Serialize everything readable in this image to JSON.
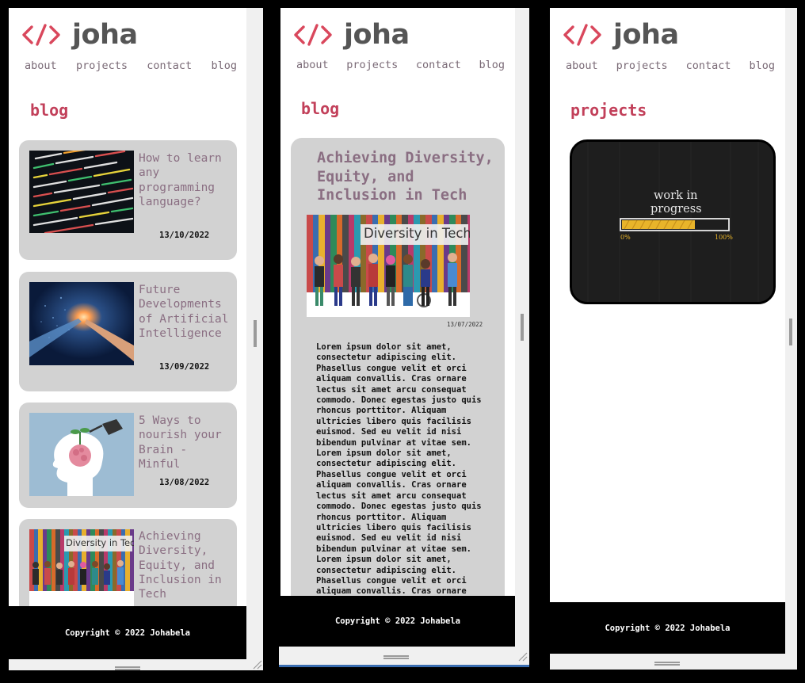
{
  "site": {
    "logo_text": "joha",
    "nav": [
      "about",
      "projects",
      "contact",
      "blog"
    ],
    "footer": "Copyright © 2022 Johabela"
  },
  "panel1": {
    "section_title": "blog",
    "cards": [
      {
        "title": "How to learn any programming language?",
        "date": "13/10/2022",
        "image": "code-screen-image"
      },
      {
        "title": "Future Developments of Artificial Intelligence",
        "date": "13/09/2022",
        "image": "robot-hand-image"
      },
      {
        "title": "5 Ways to nourish your Brain - Minful",
        "date": "13/08/2022",
        "image": "brain-watering-image"
      },
      {
        "title": "Achieving Diversity, Equity, and Inclusion in Tech",
        "date": "",
        "image": "diversity-image"
      }
    ]
  },
  "panel2": {
    "section_title": "blog",
    "article": {
      "title": "Achieving Diversity, Equity, and Inclusion in Tech",
      "image_caption": "Diversity in Tech",
      "date": "13/07/2022",
      "body": "Lorem ipsum dolor sit amet, consectetur adipiscing elit. Phasellus congue velit et orci aliquam convallis. Cras ornare lectus sit amet arcu consequat commodo. Donec egestas justo quis rhoncus porttitor. Aliquam ultricies libero quis facilisis euismod. Sed eu velit id nisi bibendum pulvinar at vitae sem. Lorem ipsum dolor sit amet, consectetur adipiscing elit. Phasellus congue velit et orci aliquam convallis. Cras ornare lectus sit amet arcu consequat commodo. Donec egestas justo quis rhoncus porttitor. Aliquam ultricies libero quis facilisis euismod. Sed eu velit id nisi bibendum pulvinar at vitae sem. Lorem ipsum dolor sit amet, consectetur adipiscing elit. Phasellus congue velit et orci aliquam convallis. Cras ornare"
    }
  },
  "panel3": {
    "section_title": "projects",
    "wip": {
      "line1": "work in",
      "line2": "progress",
      "min": "0%",
      "max": "100%"
    }
  },
  "thumb_caption": "Diversity in Tech",
  "colors": {
    "accent": "#c2405a",
    "card": "#d2d2d2",
    "title": "#8a6e82",
    "logo": "#555555"
  }
}
